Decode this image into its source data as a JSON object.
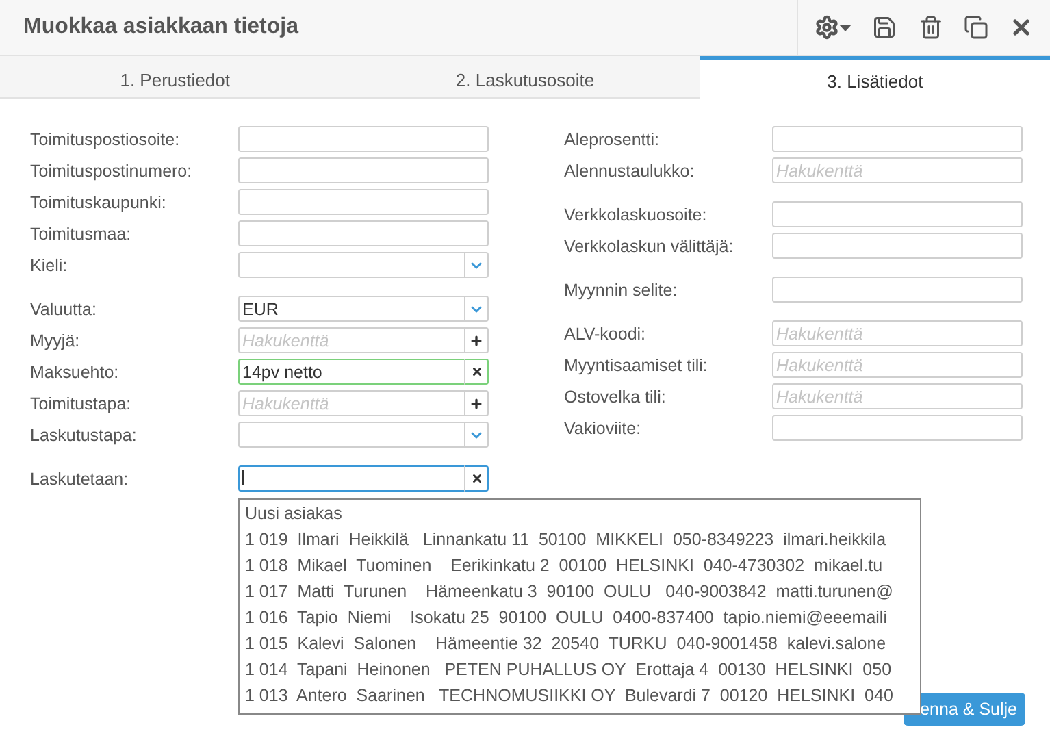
{
  "window": {
    "title": "Muokkaa asiakkaan tietoja"
  },
  "tabs": [
    {
      "label": "1. Perustiedot",
      "selected": false
    },
    {
      "label": "2. Laskutusosoite",
      "selected": false
    },
    {
      "label": "3. Lisätiedot",
      "selected": true
    }
  ],
  "left_groups": [
    [
      {
        "label": "Toimituspostiosoite:",
        "kind": "text",
        "valid": false,
        "focused": false
      },
      {
        "label": "Toimituspostinumero:",
        "kind": "text",
        "valid": false,
        "focused": false
      },
      {
        "label": "Toimituskaupunki:",
        "kind": "text",
        "valid": false,
        "focused": false
      },
      {
        "label": "Toimitusmaa:",
        "kind": "text",
        "valid": false,
        "focused": false
      },
      {
        "label": "Kieli:",
        "kind": "select",
        "valid": false,
        "focused": false
      }
    ],
    [
      {
        "label": "Valuutta:",
        "kind": "select",
        "value": "EUR",
        "valid": false,
        "focused": false
      },
      {
        "label": "Myyjä:",
        "kind": "search_add",
        "placeholder": "Hakukenttä",
        "valid": false,
        "focused": false
      },
      {
        "label": "Maksuehto:",
        "kind": "search_clear",
        "value": "14pv netto",
        "valid": true,
        "focused": false
      },
      {
        "label": "Toimitustapa:",
        "kind": "search_add",
        "placeholder": "Hakukenttä",
        "valid": false,
        "focused": false
      },
      {
        "label": "Laskutustapa:",
        "kind": "select",
        "valid": false,
        "focused": false
      }
    ],
    [
      {
        "label": "Laskutetaan:",
        "kind": "search_clear",
        "valid": false,
        "focused": true
      }
    ]
  ],
  "right_groups": [
    [
      {
        "label": "Aleprosentti:",
        "kind": "text",
        "valid": false,
        "focused": false
      },
      {
        "label": "Alennustaulukko:",
        "kind": "text",
        "placeholder": "Hakukenttä",
        "valid": false,
        "focused": false
      }
    ],
    [
      {
        "label": "Verkkolaskuosoite:",
        "kind": "text",
        "valid": false,
        "focused": false
      },
      {
        "label": "Verkkolaskun välittäjä:",
        "kind": "text",
        "valid": false,
        "focused": false
      }
    ],
    [
      {
        "label": "Myynnin selite:",
        "kind": "text",
        "valid": false,
        "focused": false
      }
    ],
    [
      {
        "label": "ALV-koodi:",
        "kind": "text",
        "placeholder": "Hakukenttä",
        "valid": false,
        "focused": false
      },
      {
        "label": "Myyntisaamiset tili:",
        "kind": "text",
        "placeholder": "Hakukenttä",
        "valid": false,
        "focused": false
      },
      {
        "label": "Ostovelka tili:",
        "kind": "text",
        "placeholder": "Hakukenttä",
        "valid": false,
        "focused": false
      },
      {
        "label": "Vakioviite:",
        "kind": "text",
        "valid": false,
        "focused": false
      }
    ]
  ],
  "suggestions": [
    "Uusi asiakas",
    "1 019  Ilmari  Heikkilä   Linnankatu 11  50100  MIKKELI  050-8349223  ilmari.heikkila",
    "1 018  Mikael  Tuominen    Eerikinkatu 2  00100  HELSINKI  040-4730302  mikael.tu",
    "1 017  Matti  Turunen    Hämeenkatu 3  90100  OULU   040-9003842  matti.turunen@",
    "1 016  Tapio  Niemi    Isokatu 25  90100  OULU  0400-837400  tapio.niemi@eeemaili",
    "1 015  Kalevi  Salonen    Hämeentie 32  20540  TURKU  040-9001458  kalevi.salone",
    "1 014  Tapani  Heinonen   PETEN PUHALLUS OY  Erottaja 4  00130  HELSINKI  050",
    "1 013  Antero  Saarinen   TECHNOMUSIIKKI OY  Bulevardi 7  00120  HELSINKI  040"
  ],
  "save_button": "enna & Sulje"
}
